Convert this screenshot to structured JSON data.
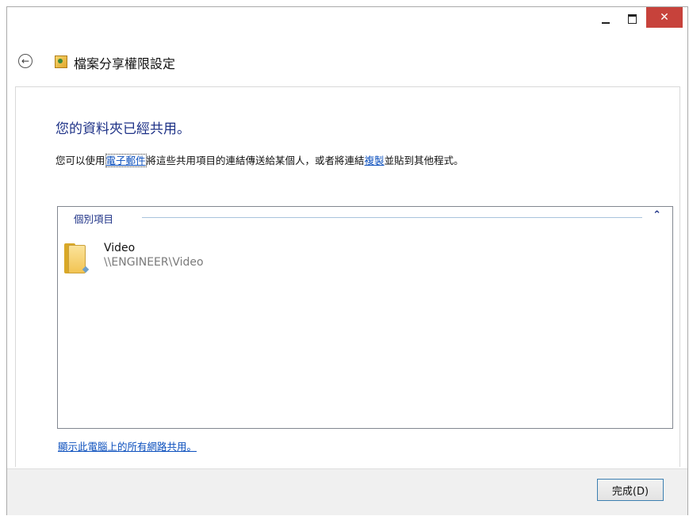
{
  "window": {
    "minimize_glyph": "",
    "close_glyph": "✕"
  },
  "header": {
    "back_glyph": "←",
    "title": "檔案分享權限設定",
    "icon": "sharing-wizard-icon"
  },
  "main": {
    "heading": "您的資料夾已經共用。",
    "description": {
      "part1": "您可以使用",
      "email_link": "電子郵件",
      "part2": "將這些共用項目的連結傳送給某個人，或者將連結",
      "copy_link": "複製",
      "part3": "並貼到其他程式。"
    },
    "group": {
      "label": "個別項目",
      "chevron": "⌃"
    },
    "items": [
      {
        "name": "Video",
        "path": "\\\\ENGINEER\\Video",
        "icon": "folder-icon"
      }
    ],
    "show_all_link": "顯示此電腦上的所有網路共用。"
  },
  "footer": {
    "done_label": "完成(D)"
  },
  "colors": {
    "accent": "#1e3287",
    "link": "#0b4fbd",
    "close_button": "#c7423b"
  }
}
